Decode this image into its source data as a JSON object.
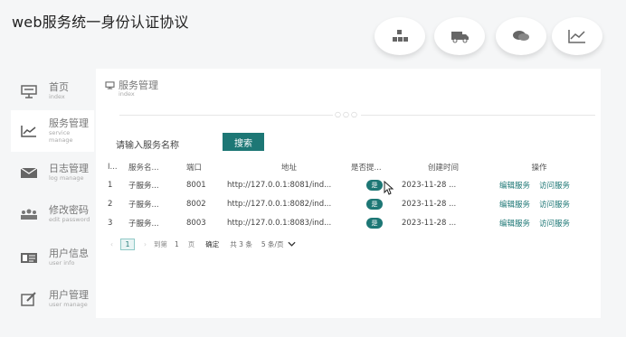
{
  "app": {
    "title": "web服务统一身份认证协议"
  },
  "top_icons": [
    "boxes-icon",
    "truck-icon",
    "chat-icon",
    "line-chart-icon"
  ],
  "sidebar": {
    "items": [
      {
        "label": "首页",
        "sub": "index",
        "icon": "presentation-icon"
      },
      {
        "label": "服务管理",
        "sub": "service manage",
        "icon": "line-chart-icon",
        "active": true
      },
      {
        "label": "日志管理",
        "sub": "log manage",
        "icon": "mail-icon"
      },
      {
        "label": "修改密码",
        "sub": "edit password",
        "icon": "people-icon"
      },
      {
        "label": "用户信息",
        "sub": "user info",
        "icon": "id-card-icon"
      },
      {
        "label": "用户管理",
        "sub": "user manage",
        "icon": "edit-icon"
      }
    ]
  },
  "breadcrumb": {
    "label": "服务管理",
    "sub": "index"
  },
  "search": {
    "placeholder": "请输入服务名称",
    "button": "搜索"
  },
  "table": {
    "headers": [
      "I...",
      "服务名...",
      "端口",
      "地址",
      "是否提...",
      "创建时间",
      "操作"
    ],
    "rows": [
      {
        "id": "1",
        "name": "子服务...",
        "port": "8001",
        "addr": "http://127.0.0.1:8081/ind...",
        "flag": "是",
        "time": "2023-11-28 ...",
        "edit": "编辑服务",
        "visit": "访问服务"
      },
      {
        "id": "2",
        "name": "子服务...",
        "port": "8002",
        "addr": "http://127.0.0.1:8082/ind...",
        "flag": "是",
        "time": "2023-11-28 ...",
        "edit": "编辑服务",
        "visit": "访问服务"
      },
      {
        "id": "3",
        "name": "子服务...",
        "port": "8003",
        "addr": "http://127.0.0.1:8083/ind...",
        "flag": "是",
        "time": "2023-11-28 ...",
        "edit": "编辑服务",
        "visit": "访问服务"
      }
    ]
  },
  "pager": {
    "prev": "‹",
    "current": "1",
    "next": "›",
    "goto": "到第",
    "page_input": "1",
    "page_unit": "页",
    "confirm": "确定",
    "total": "共 3 条",
    "page_size": "5 条/页"
  },
  "colors": {
    "accent": "#1d7775"
  }
}
